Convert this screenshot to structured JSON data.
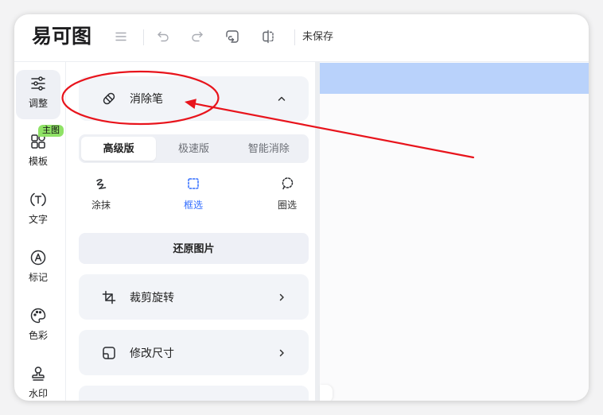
{
  "app": {
    "logo_text": "易可图",
    "save_status": "未保存"
  },
  "toolbar": {
    "icons": [
      "menu-icon",
      "undo-icon",
      "redo-icon",
      "reset-icon",
      "compare-icon"
    ]
  },
  "sidebar": {
    "badge": "主图",
    "items": [
      {
        "label": "调整",
        "icon": "sliders-icon",
        "selected": true
      },
      {
        "label": "模板",
        "icon": "template-icon",
        "selected": false
      },
      {
        "label": "文字",
        "icon": "text-icon",
        "selected": false
      },
      {
        "label": "标记",
        "icon": "mark-icon",
        "selected": false
      },
      {
        "label": "色彩",
        "icon": "palette-icon",
        "selected": false
      },
      {
        "label": "水印",
        "icon": "stamp-icon",
        "selected": false
      }
    ]
  },
  "panel": {
    "header": {
      "title": "消除笔",
      "icon": "eraser-icon",
      "expanded": true
    },
    "tabs": [
      {
        "label": "高级版",
        "selected": true
      },
      {
        "label": "极速版",
        "selected": false
      },
      {
        "label": "智能消除",
        "selected": false
      }
    ],
    "tools": [
      {
        "label": "涂抹",
        "icon": "scribble-icon",
        "selected": false
      },
      {
        "label": "框选",
        "icon": "rect-select-icon",
        "selected": true
      },
      {
        "label": "圈选",
        "icon": "lasso-select-icon",
        "selected": false
      }
    ],
    "restore_button": "还原图片",
    "sections": [
      {
        "label": "裁剪旋转",
        "icon": "crop-icon"
      },
      {
        "label": "修改尺寸",
        "icon": "resize-icon"
      }
    ]
  },
  "colors": {
    "accent": "#2f6bff",
    "badge": "#8fe266",
    "annotation": "#e8141c",
    "canvas_band": "#b9d2fb"
  }
}
